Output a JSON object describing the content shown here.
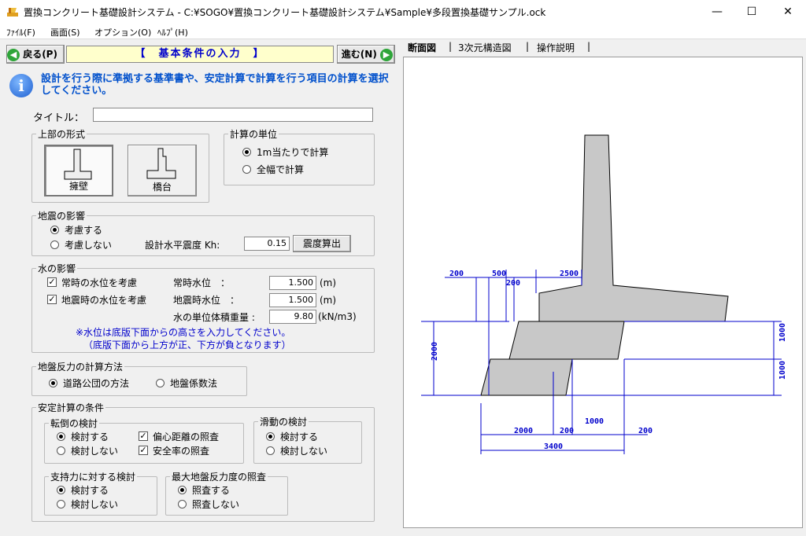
{
  "window": {
    "title": "置換コンクリート基礎設計システム - C:¥SOGO¥置換コンクリート基礎設計システム¥Sample¥多段置換基礎サンプル.ock",
    "minimize": "—",
    "maximize": "☐",
    "close": "✕"
  },
  "menu": {
    "file": "ﾌｧｲﾙ(F)",
    "screen": "画面(S)",
    "option": "オプション(O)",
    "help": "ﾍﾙﾌﾟ(H)"
  },
  "nav": {
    "back": "戻る(P)",
    "header": "【　基本条件の入力　】",
    "next": "進む(N)"
  },
  "instruction": "設計を行う際に準拠する基準書や、安定計算で計算を行う項目の計算を選択してください。",
  "title_field": {
    "label": "タイトル：",
    "value": ""
  },
  "structure_type": {
    "title": "上部の形式",
    "options": [
      {
        "label": "擁壁",
        "selected": true
      },
      {
        "label": "橋台",
        "selected": false
      }
    ]
  },
  "calc_unit": {
    "title": "計算の単位",
    "options": [
      {
        "label": "1m当たりで計算",
        "selected": true
      },
      {
        "label": "全幅で計算",
        "selected": false
      }
    ]
  },
  "earthquake": {
    "title": "地震の影響",
    "options": [
      {
        "label": "考慮する",
        "selected": true
      },
      {
        "label": "考慮しない",
        "selected": false
      }
    ],
    "kh_label": "設計水平震度 Kh:",
    "kh_value": "0.15",
    "calc_button": "震度算出"
  },
  "water": {
    "title": "水の影響",
    "normal_check": "常時の水位を考慮",
    "normal_label": "常時水位　：",
    "normal_value": "1.500",
    "normal_unit": "(m)",
    "quake_check": "地震時の水位を考慮",
    "quake_label": "地震時水位　：",
    "quake_value": "1.500",
    "quake_unit": "(m)",
    "weight_label": "水の単位体積重量 :",
    "weight_value": "9.80",
    "weight_unit": "(kN/m3)",
    "note1": "※水位は底版下面からの高さを入力してください。",
    "note2": "（底版下面から上方が正、下方が負となります）"
  },
  "reaction_method": {
    "title": "地盤反力の計算方法",
    "options": [
      {
        "label": "道路公団の方法",
        "selected": true
      },
      {
        "label": "地盤係数法",
        "selected": false
      }
    ]
  },
  "stability": {
    "title": "安定計算の条件",
    "overturn": {
      "title": "転倒の検討",
      "options": [
        {
          "label": "検討する",
          "selected": true
        },
        {
          "label": "検討しない",
          "selected": false
        }
      ],
      "checks": [
        {
          "label": "偏心距離の照査",
          "checked": true
        },
        {
          "label": "安全率の照査",
          "checked": true
        }
      ]
    },
    "sliding": {
      "title": "滑動の検討",
      "options": [
        {
          "label": "検討する",
          "selected": true
        },
        {
          "label": "検討しない",
          "selected": false
        }
      ]
    },
    "bearing": {
      "title": "支持力に対する検討",
      "options": [
        {
          "label": "検討する",
          "selected": true
        },
        {
          "label": "検討しない",
          "selected": false
        }
      ]
    },
    "max_reaction": {
      "title": "最大地盤反力度の照査",
      "options": [
        {
          "label": "照査する",
          "selected": true
        },
        {
          "label": "照査しない",
          "selected": false
        }
      ]
    }
  },
  "tabs": [
    {
      "label": "断面図",
      "active": true
    },
    {
      "label": "3次元構造図",
      "active": false
    },
    {
      "label": "操作説明",
      "active": false
    }
  ],
  "drawing": {
    "dims": {
      "d200_left": "200",
      "d500": "500",
      "d200_top": "200",
      "d2500": "2500",
      "d2000_v": "2000",
      "d1000_v1": "1000",
      "d1000_v2": "1000",
      "d2000_h": "2000",
      "d200_bot": "200",
      "d1000_h": "1000",
      "d200_right": "200",
      "d3400": "3400"
    },
    "fill_color": "#c8c8c8",
    "dim_color": "#0000cc"
  }
}
